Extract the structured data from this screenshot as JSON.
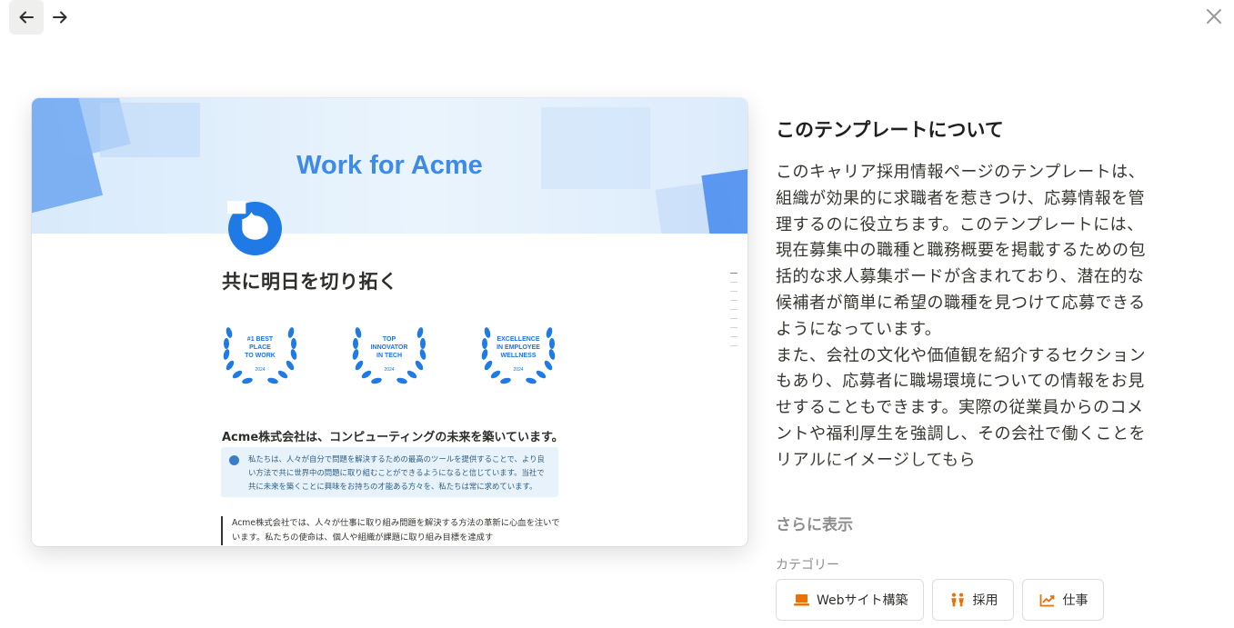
{
  "nav": {
    "back_icon": "arrow-left-icon",
    "forward_icon": "arrow-right-icon",
    "close_icon": "close-icon"
  },
  "preview": {
    "cover_title": "Work for Acme",
    "heading": "共に明日を切り拓く",
    "badges": [
      {
        "lines": [
          "#1 BEST",
          "PLACE",
          "TO WORK"
        ],
        "year": "2024"
      },
      {
        "lines": [
          "TOP",
          "INNOVATOR",
          "IN TECH"
        ],
        "year": "2024"
      },
      {
        "lines": [
          "EXCELLENCE",
          "IN EMPLOYEE",
          "WELLNESS"
        ],
        "year": "2024"
      }
    ],
    "subheading": "Acme株式会社は、コンピューティングの未来を築いています。",
    "callout": "私たちは、人々が自分で問題を解決するための最高のツールを提供することで、より良い方法で共に世界中の問題に取り組むことができるようになると信じています。当社で共に未来を築くことに興味をお持ちの才能ある方々を、私たちは常に求めています。",
    "quote": "Acme株式会社では、人々が仕事に取り組み問題を解決する方法の革新に心血を注いでいます。私たちの使命は、個人や組織が課題に取り組み目標を達成す",
    "colors": {
      "accent": "#3d8ae8",
      "icon": "#1a73e8"
    }
  },
  "about": {
    "title": "このテンプレートについて",
    "description_1": "このキャリア採用情報ページのテンプレートは、組織が効果的に求職者を惹きつけ、応募情報を管理するのに役立ちます。このテンプレートには、現在募集中の職種と職務概要を掲載するための包括的な求人募集ボードが含まれており、潜在的な候補者が簡単に希望の職種を見つけて応募できるようになっています。",
    "description_2": "また、会社の文化や価値観を紹介するセクションもあり、応募者に職場環境についての情報をお見せすることもできます。実際の従業員からのコメントや福利厚生を強調し、その会社で働くことをリアルにイメージしてもら",
    "show_more": "さらに表示",
    "categories_label": "カテゴリー",
    "categories": [
      {
        "label": "Webサイト構築",
        "icon": "laptop-icon"
      },
      {
        "label": "採用",
        "icon": "people-icon"
      },
      {
        "label": "仕事",
        "icon": "trend-chart-icon"
      }
    ],
    "category_icon_color": "#e8710a"
  }
}
